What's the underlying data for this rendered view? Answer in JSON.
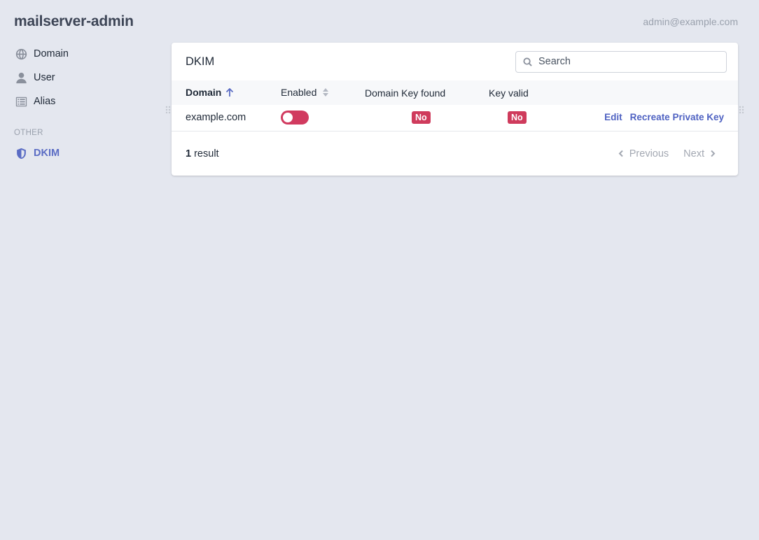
{
  "app": {
    "brand": "mailserver-admin",
    "user_email": "admin@example.com"
  },
  "sidebar": {
    "items": [
      {
        "label": "Domain",
        "icon": "globe-icon"
      },
      {
        "label": "User",
        "icon": "user-icon"
      },
      {
        "label": "Alias",
        "icon": "list-icon"
      }
    ],
    "section_label": "OTHER",
    "other_items": [
      {
        "label": "DKIM",
        "icon": "shield-icon",
        "active": true
      }
    ]
  },
  "card": {
    "title": "DKIM",
    "search": {
      "placeholder": "Search",
      "value": ""
    },
    "columns": [
      {
        "label": "Domain",
        "sort": "asc"
      },
      {
        "label": "Enabled",
        "sort": "none"
      },
      {
        "label": "Domain Key found"
      },
      {
        "label": "Key valid"
      }
    ],
    "rows": [
      {
        "domain": "example.com",
        "enabled": false,
        "key_found": "No",
        "key_valid": "No",
        "actions": [
          "Edit",
          "Recreate Private Key"
        ]
      }
    ],
    "footer": {
      "count": "1",
      "count_suffix": " result",
      "prev_label": "Previous",
      "next_label": "Next"
    }
  },
  "colors": {
    "accent": "#5a6cc4",
    "danger": "#cf3b5c",
    "background": "#e4e7ef"
  }
}
